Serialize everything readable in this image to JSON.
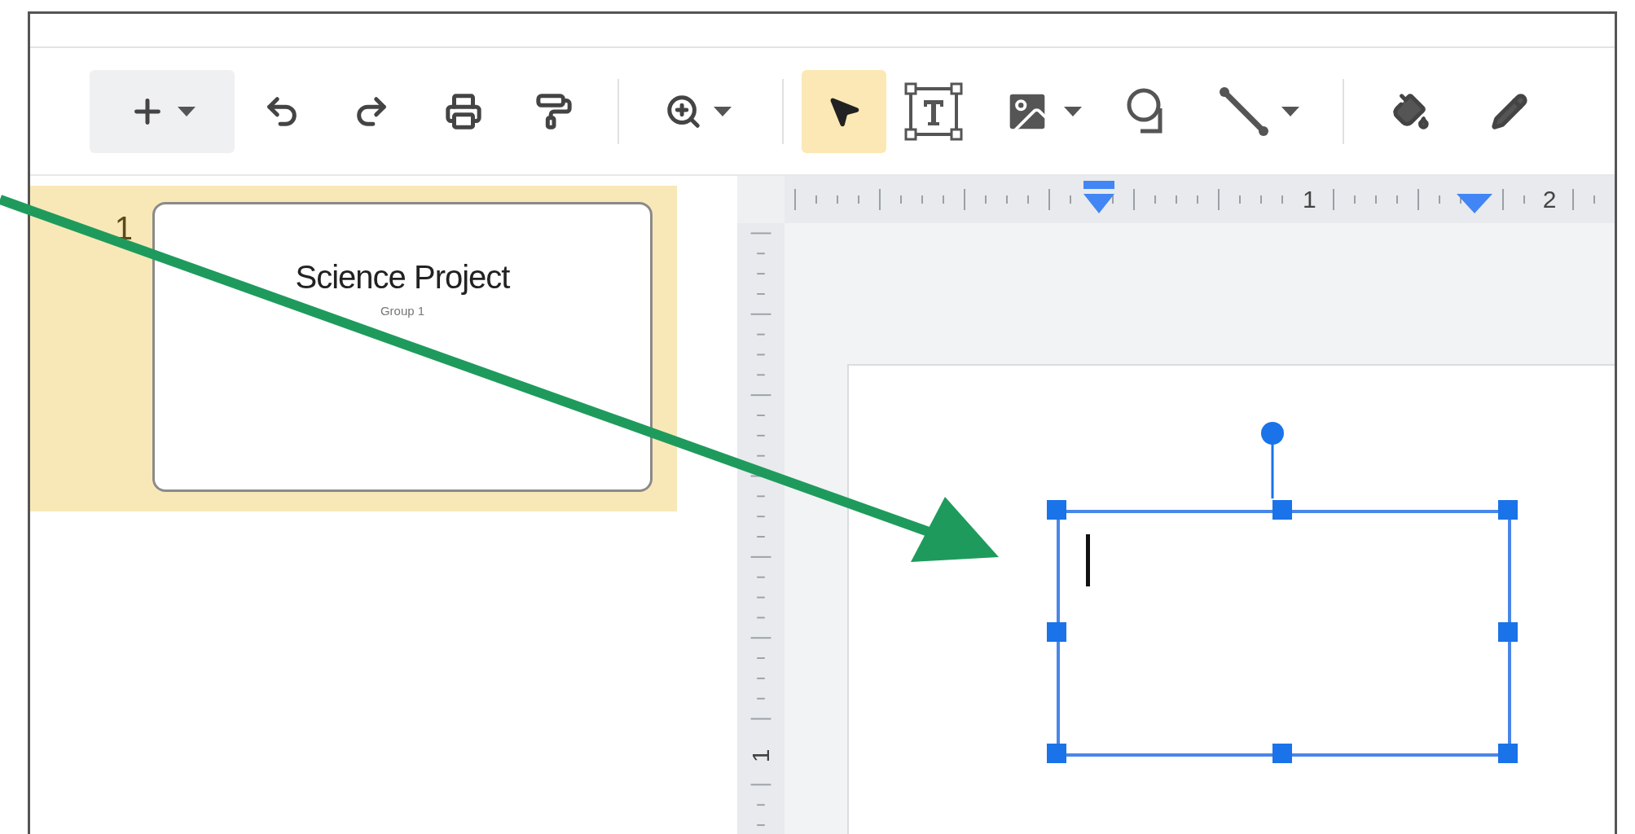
{
  "toolbar": {
    "items": [
      {
        "kind": "new_slide",
        "caret": true,
        "hovered": true,
        "selected": false
      },
      {
        "kind": "undo",
        "caret": false,
        "hovered": false,
        "selected": false
      },
      {
        "kind": "redo",
        "caret": false,
        "hovered": false,
        "selected": false
      },
      {
        "kind": "print",
        "caret": false,
        "hovered": false,
        "selected": false
      },
      {
        "kind": "paint_format",
        "caret": false,
        "hovered": false,
        "selected": false
      },
      {
        "kind": "divider"
      },
      {
        "kind": "zoom",
        "caret": true,
        "hovered": false,
        "selected": false
      },
      {
        "kind": "divider"
      },
      {
        "kind": "select",
        "caret": false,
        "hovered": false,
        "selected": true
      },
      {
        "kind": "text_box",
        "caret": false,
        "hovered": false,
        "selected": false
      },
      {
        "kind": "image",
        "caret": true,
        "hovered": false,
        "selected": false
      },
      {
        "kind": "shape",
        "caret": false,
        "hovered": false,
        "selected": false
      },
      {
        "kind": "line",
        "caret": true,
        "hovered": false,
        "selected": false
      },
      {
        "kind": "divider"
      },
      {
        "kind": "fill_color",
        "caret": false,
        "hovered": false,
        "selected": false
      },
      {
        "kind": "border_color",
        "caret": false,
        "hovered": false,
        "selected": false
      }
    ]
  },
  "filmstrip": {
    "slides": [
      {
        "number": "1",
        "selected": true,
        "title": "Science Project",
        "subtitle": "Group 1"
      }
    ]
  },
  "rulers": {
    "horizontal_labels": [
      "1",
      "2"
    ],
    "vertical_labels": [
      "1"
    ]
  },
  "slide": {
    "text_box": {
      "selected": true,
      "editing": true
    }
  },
  "annotation": {
    "arrow": true
  }
}
